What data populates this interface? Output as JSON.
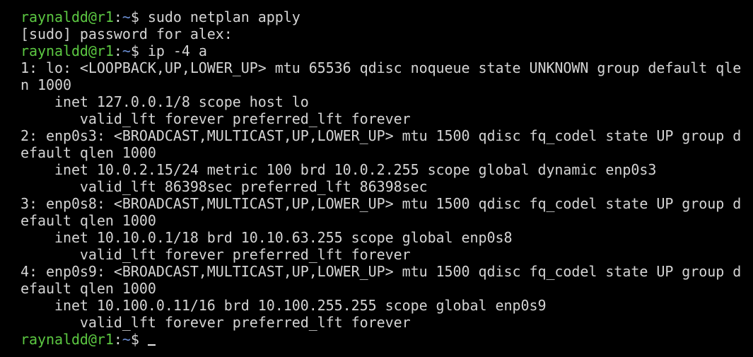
{
  "terminal": {
    "colors": {
      "background": "#000000",
      "text": "#d4d4d4",
      "prompt_user": "#5cc842",
      "prompt_path": "#6b8fd4"
    },
    "prompt": {
      "user_host": "raynaldd@r1",
      "separator": ":",
      "path": "~",
      "symbol": "$ "
    },
    "lines": {
      "l1": "sudo netplan apply",
      "l2": "[sudo] password for alex:",
      "l3": "ip -4 a",
      "l4": "1: lo: <LOOPBACK,UP,LOWER_UP> mtu 65536 qdisc noqueue state UNKNOWN group default qle",
      "l5": "n 1000",
      "l6": "    inet 127.0.0.1/8 scope host lo",
      "l7": "       valid_lft forever preferred_lft forever",
      "l8": "2: enp0s3: <BROADCAST,MULTICAST,UP,LOWER_UP> mtu 1500 qdisc fq_codel state UP group d",
      "l9": "efault qlen 1000",
      "l10": "    inet 10.0.2.15/24 metric 100 brd 10.0.2.255 scope global dynamic enp0s3",
      "l11": "       valid_lft 86398sec preferred_lft 86398sec",
      "l12": "3: enp0s8: <BROADCAST,MULTICAST,UP,LOWER_UP> mtu 1500 qdisc fq_codel state UP group d",
      "l13": "efault qlen 1000",
      "l14": "    inet 10.10.0.1/18 brd 10.10.63.255 scope global enp0s8",
      "l15": "       valid_lft forever preferred_lft forever",
      "l16": "4: enp0s9: <BROADCAST,MULTICAST,UP,LOWER_UP> mtu 1500 qdisc fq_codel state UP group d",
      "l17": "efault qlen 1000",
      "l18": "    inet 10.100.0.11/16 brd 10.100.255.255 scope global enp0s9",
      "l19": "       valid_lft forever preferred_lft forever"
    }
  }
}
